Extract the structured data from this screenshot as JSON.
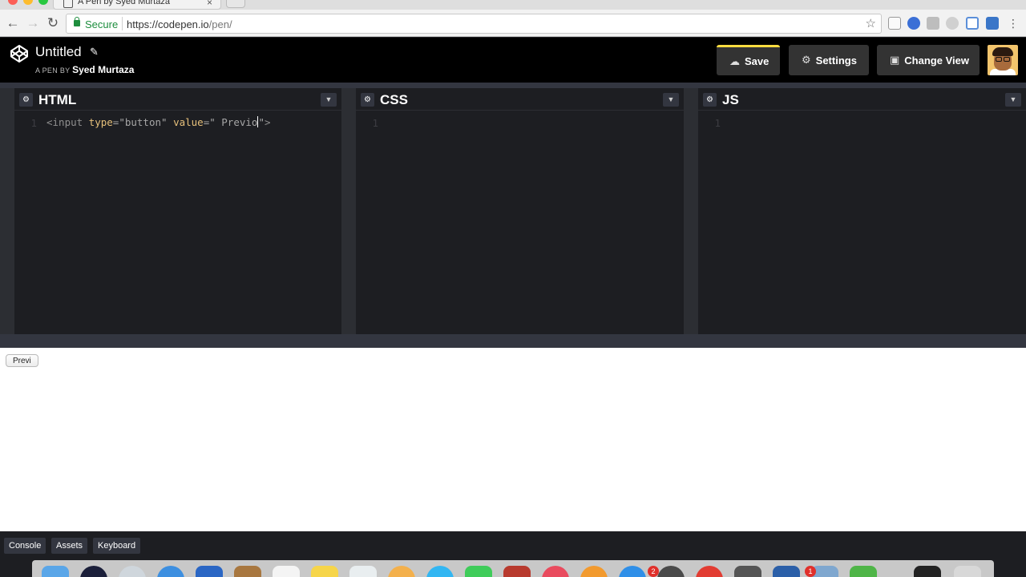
{
  "browser": {
    "tab_title": "A Pen by Syed Murtaza",
    "tab_close": "×",
    "secure_label": "Secure",
    "url_scheme": "https://codepen.io",
    "url_path": "/pen/"
  },
  "pen": {
    "title": "Untitled",
    "byline_prefix": "A PEN BY",
    "author": "Syed Murtaza"
  },
  "header_buttons": {
    "save": "Save",
    "settings": "Settings",
    "change_view": "Change View"
  },
  "editors": {
    "html": {
      "title": "HTML",
      "line_number": "1"
    },
    "css": {
      "title": "CSS",
      "line_number": "1"
    },
    "js": {
      "title": "JS",
      "line_number": "1"
    }
  },
  "html_code": {
    "open": "<input",
    "attr1": "type",
    "val1": "=\"button\"",
    "attr2": "value",
    "val2_before_caret": "=\" Previo",
    "val2_after_caret": "\"",
    "close": ">"
  },
  "preview": {
    "button_label": "Previ"
  },
  "footer": {
    "console": "Console",
    "assets": "Assets",
    "keyboard": "Keyboard"
  },
  "dock": {
    "badge_1": "2",
    "badge_2": "1"
  },
  "colors": {
    "save_accent": "#ffdd40",
    "editor_bg": "#1d1e22",
    "header_bg": "#000000",
    "button_bg": "#333640"
  }
}
